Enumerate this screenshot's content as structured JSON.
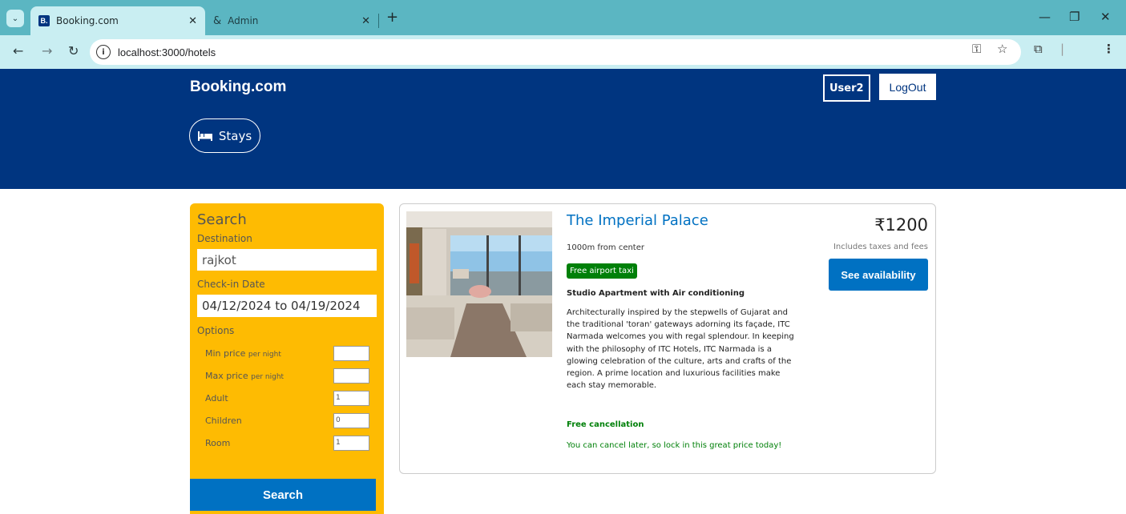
{
  "browser": {
    "tabs": [
      {
        "label": "Booking.com",
        "favicon": "B.",
        "active": true
      },
      {
        "label": "Admin",
        "icon": "admin-people-icon",
        "active": false
      }
    ],
    "url": "localhost:3000/hotels"
  },
  "header": {
    "brand": "Booking.com",
    "user": "User2",
    "logout": "LogOut",
    "stays": "Stays",
    "bg_color": "#003580"
  },
  "search": {
    "title": "Search",
    "destination_label": "Destination",
    "destination_value": "rajkot",
    "checkin_label": "Check-in Date",
    "checkin_value": "04/12/2024 to 04/19/2024",
    "options_label": "Options",
    "options": [
      {
        "label": "Min price",
        "suffix": "per night",
        "value": ""
      },
      {
        "label": "Max price",
        "suffix": "per night",
        "value": ""
      },
      {
        "label": "Adult",
        "suffix": "",
        "value": "1"
      },
      {
        "label": "Children",
        "suffix": "",
        "value": "0"
      },
      {
        "label": "Room",
        "suffix": "",
        "value": "1"
      }
    ],
    "button": "Search",
    "panel_color": "#febb02"
  },
  "result": {
    "name": "The Imperial Palace",
    "distance": "1000m from center",
    "taxi": "Free airport taxi",
    "room_type": "Studio Apartment with Air conditioning",
    "description": "Architecturally inspired by the stepwells of Gujarat and the traditional 'toran' gateways adorning its façade, ITC Narmada welcomes you with regal splendour. In keeping with the philosophy of ITC Hotels, ITC Narmada is a glowing celebration of the culture, arts and crafts of the region. A prime location and luxurious facilities make each stay memorable.",
    "cancel_title": "Free cancellation",
    "cancel_sub": "You can cancel later, so lock in this great price today!",
    "price": "₹1200",
    "taxes": "Includes taxes and fees",
    "availability_button": "See availability",
    "accent_color": "#0071c2",
    "green_color": "#008009"
  }
}
